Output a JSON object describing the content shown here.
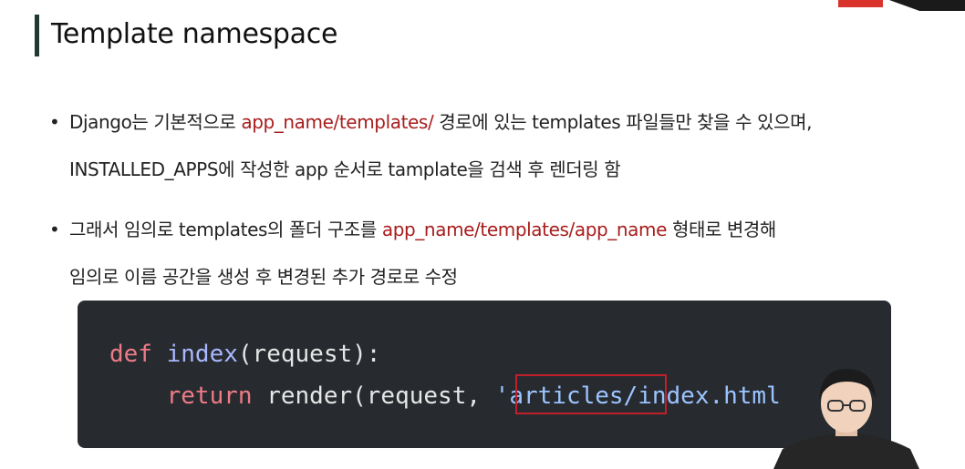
{
  "slide": {
    "title": "Template namespace"
  },
  "bullets": [
    {
      "lines": [
        [
          {
            "text": "Django는 기본적으로 ",
            "red": false
          },
          {
            "text": "app_name/templates/",
            "red": true
          },
          {
            "text": " 경로에 있는 templates 파일들만 찾을 수 있으며,",
            "red": false
          }
        ],
        [
          {
            "text": "INSTALLED_APPS에 작성한 app 순서로 tamplate을 검색 후 렌더링 함",
            "red": false
          }
        ]
      ]
    },
    {
      "lines": [
        [
          {
            "text": "그래서 임의로 templates의 폴더 구조를 ",
            "red": false
          },
          {
            "text": "app_name/templates/app_name",
            "red": true
          },
          {
            "text": " 형태로 변경해",
            "red": false
          }
        ],
        [
          {
            "text": "임의로 이름 공간을 생성 후 변경된 추가 경로로 수정",
            "red": false
          }
        ]
      ]
    }
  ],
  "code": {
    "line1": {
      "kw": "def",
      "fn": "index",
      "rest": "(request):"
    },
    "line2": {
      "kw": "return",
      "fn": "render",
      "args": "(request, ",
      "str": "'articles/index.html"
    }
  },
  "colors": {
    "accent_red": "#a81d1d",
    "title_bar": "#1f3a2e",
    "code_bg": "#272b30",
    "highlight_border": "#c0202a"
  }
}
